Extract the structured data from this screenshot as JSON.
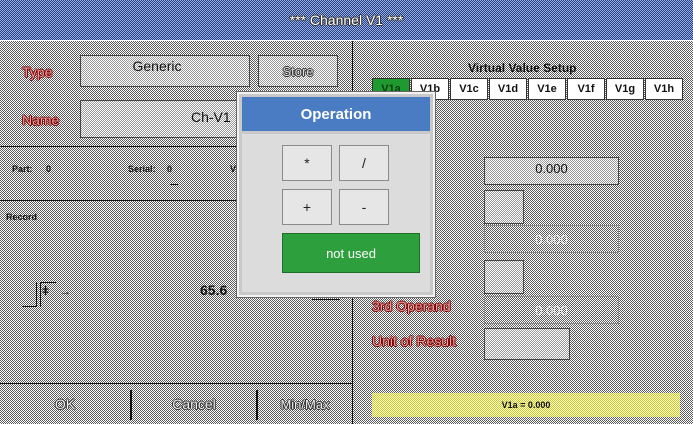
{
  "title": "*** Channel V1 ***",
  "left": {
    "type_label": "Type",
    "type_value": "Generic",
    "store_label": "Store",
    "name_label": "Name",
    "name_value": "Ch-V1",
    "part_label": "Part:",
    "part_value": "0",
    "serial_label": "Serial:",
    "serial_value": "0",
    "v_label": "V",
    "record_label": "Record",
    "reading_value": "65.6",
    "arrow_glyph": "→"
  },
  "buttons": {
    "ok": "OK",
    "cancel": "Cancel",
    "minmax": "Min/Max"
  },
  "right": {
    "section_title": "Virtual Value Setup",
    "tabs": [
      "V1a",
      "V1b",
      "V1c",
      "V1d",
      "V1e",
      "V1f",
      "V1g",
      "V1h"
    ],
    "first_operand_value": "0.000",
    "second_operand_value": "0.000",
    "third_operand_label": "3rd Operand",
    "third_operand_value": "0.000",
    "unit_label": "Unit of Result",
    "status": "V1a = 0.000"
  },
  "dialog": {
    "title": "Operation",
    "ops": [
      "*",
      "/",
      "+",
      "-"
    ],
    "not_used": "not used"
  },
  "colors": {
    "accent_blue": "#4a7cc4",
    "green": "#2d9f3d",
    "label_red": "#c00000"
  }
}
